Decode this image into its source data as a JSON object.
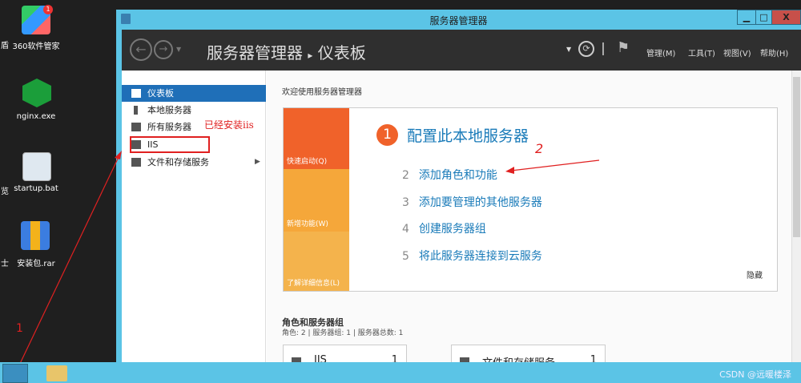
{
  "desktop": {
    "icons": [
      {
        "label": "360软件管家"
      },
      {
        "label": "nginx.exe"
      },
      {
        "label": "startup.bat"
      },
      {
        "label": "安装包.rar"
      }
    ],
    "partial_labels": [
      "盾",
      "览",
      "士"
    ],
    "badge": "1"
  },
  "window": {
    "title": "服务器管理器",
    "minimize": "▁",
    "maximize": "□",
    "close": "X"
  },
  "header": {
    "breadcrumb_app": "服务器管理器",
    "breadcrumb_sep": "▸",
    "breadcrumb_page": "仪表板",
    "menus": [
      "管理(M)",
      "工具(T)",
      "视图(V)",
      "帮助(H)"
    ]
  },
  "sidebar": {
    "items": [
      {
        "label": "仪表板"
      },
      {
        "label": "本地服务器"
      },
      {
        "label": "所有服务器"
      },
      {
        "label": "IIS"
      },
      {
        "label": "文件和存储服务"
      }
    ]
  },
  "main": {
    "welcome": "欢迎使用服务器管理器",
    "quick_start": "快速启动(Q)",
    "new_features": "新增功能(W)",
    "learn_more": "了解详细信息(L)",
    "step1_num": "1",
    "step1": "配置此本地服务器",
    "steps": [
      {
        "num": "2",
        "label": "添加角色和功能"
      },
      {
        "num": "3",
        "label": "添加要管理的其他服务器"
      },
      {
        "num": "4",
        "label": "创建服务器组"
      },
      {
        "num": "5",
        "label": "将此服务器连接到云服务"
      }
    ],
    "hide": "隐藏",
    "roles_title": "角色和服务器组",
    "roles_summary": "角色: 2 | 服务器组: 1 | 服务器总数: 1",
    "cards": [
      {
        "name": "IIS",
        "count": "1"
      },
      {
        "name": "文件和存储服务",
        "count": "1"
      }
    ]
  },
  "annotations": {
    "installed": "已经安装iis",
    "mark1": "1",
    "mark2": "2"
  },
  "taskbar": {
    "watermark": "CSDN @远暖楼泽"
  },
  "colors": {
    "accent": "#5bc4e6",
    "orange": "#f0622a",
    "amber": "#f5a73a"
  }
}
